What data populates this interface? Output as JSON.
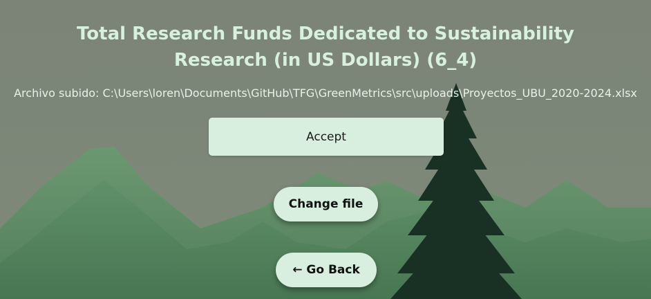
{
  "page": {
    "title": "Total Research Funds Dedicated to Sustainability Research (in US Dollars) (6_4)",
    "file_info": "Archivo subido: C:\\Users\\loren\\Documents\\GitHub\\TFG\\GreenMetrics\\src\\uploads\\Proyectos_UBU_2020-2024.xlsx"
  },
  "buttons": {
    "accept": "Accept",
    "change_file": "Change file",
    "go_back": "← Go Back"
  },
  "colors": {
    "sky": "#7a8778",
    "mountain_far": "#5c8a63",
    "mountain_near": "#4a7a54",
    "tree": "#1a3226",
    "button_bg": "#d8efe0",
    "title_text": "#d8f0de"
  },
  "background": {
    "scene": "mountains-and-pine-tree"
  }
}
